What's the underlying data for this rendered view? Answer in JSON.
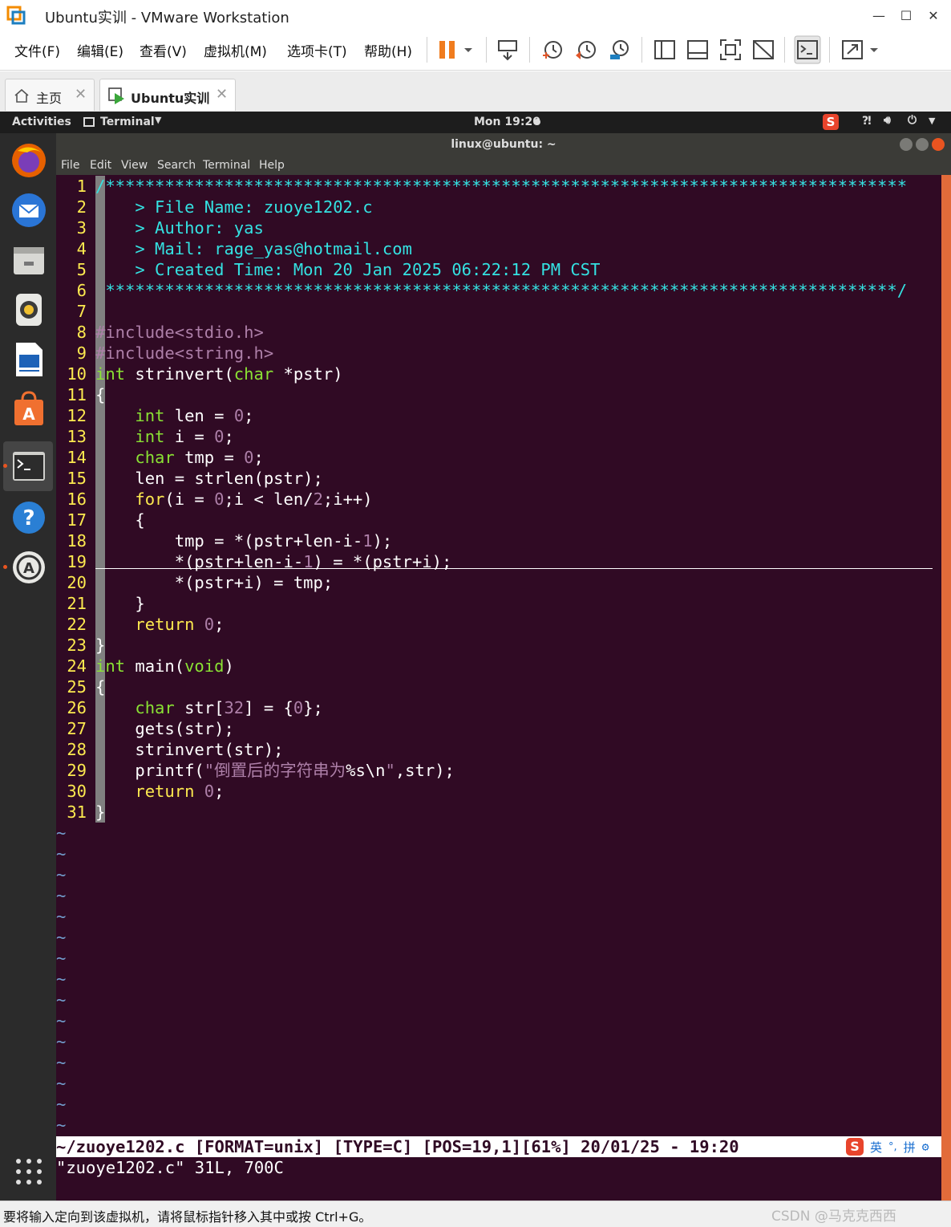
{
  "window": {
    "title": "Ubuntu实训 - VMware Workstation",
    "controls": [
      "—",
      "☐",
      "✕"
    ]
  },
  "menubar": {
    "items": [
      "文件(F)",
      "编辑(E)",
      "查看(V)",
      "虚拟机(M)",
      "选项卡(T)",
      "帮助(H)"
    ]
  },
  "toolbar": {
    "icons": [
      "pause-icon",
      "dropdown-icon",
      "send-ctrl-alt-del-icon",
      "snapshot-icon",
      "revert-snapshot-icon",
      "snapshot-manager-icon",
      "sidebar-icon",
      "thumbnail-icon",
      "fullscreen-icon",
      "unity-icon",
      "console-view-icon",
      "stretch-icon"
    ]
  },
  "tabs": [
    {
      "label": "主页",
      "icon": "home-icon",
      "active": false
    },
    {
      "label": "Ubuntu实训",
      "icon": "vm-running-icon",
      "active": true
    }
  ],
  "ubuntu": {
    "activities": "Activities",
    "app_menu": "Terminal",
    "clock": "Mon 19:20",
    "dock": [
      "firefox-icon",
      "thunderbird-icon",
      "files-icon",
      "rhythmbox-icon",
      "writer-icon",
      "software-icon",
      "terminal-icon",
      "help-icon",
      "updater-icon"
    ],
    "apps_grid_icon": "show-applications-icon"
  },
  "terminal": {
    "title": "linux@ubuntu: ~",
    "menu": [
      "File",
      "Edit",
      "View",
      "Search",
      "Terminal",
      "Help"
    ]
  },
  "vim": {
    "lines": [
      {
        "n": "1",
        "segs": [
          {
            "t": "/*********************************************************************************",
            "c": "cyan"
          }
        ]
      },
      {
        "n": "2",
        "segs": [
          {
            "t": "    > File Name: zuoye1202.c",
            "c": "cyan"
          }
        ]
      },
      {
        "n": "3",
        "segs": [
          {
            "t": "    > Author: yas",
            "c": "cyan"
          }
        ]
      },
      {
        "n": "4",
        "segs": [
          {
            "t": "    > Mail: rage_yas@hotmail.com",
            "c": "cyan"
          }
        ]
      },
      {
        "n": "5",
        "segs": [
          {
            "t": "    > Created Time: Mon 20 Jan 2025 06:22:12 PM CST",
            "c": "cyan"
          }
        ]
      },
      {
        "n": "6",
        "segs": [
          {
            "t": " ********************************************************************************/",
            "c": "cyan"
          }
        ]
      },
      {
        "n": "7",
        "segs": []
      },
      {
        "n": "8",
        "segs": [
          {
            "t": "#include<stdio.h>",
            "c": "purple"
          }
        ]
      },
      {
        "n": "9",
        "segs": [
          {
            "t": "#include<string.h>",
            "c": "purple"
          }
        ]
      },
      {
        "n": "10",
        "segs": [
          {
            "t": "int",
            "c": "green"
          },
          {
            "t": " strinvert(",
            "c": "white"
          },
          {
            "t": "char",
            "c": "green"
          },
          {
            "t": " *pstr)",
            "c": "white"
          }
        ]
      },
      {
        "n": "11",
        "segs": [
          {
            "t": "{",
            "c": "white"
          }
        ]
      },
      {
        "n": "12",
        "segs": [
          {
            "t": "    ",
            "c": "white"
          },
          {
            "t": "int",
            "c": "green"
          },
          {
            "t": " len = ",
            "c": "white"
          },
          {
            "t": "0",
            "c": "purple"
          },
          {
            "t": ";",
            "c": "white"
          }
        ]
      },
      {
        "n": "13",
        "segs": [
          {
            "t": "    ",
            "c": "white"
          },
          {
            "t": "int",
            "c": "green"
          },
          {
            "t": " i = ",
            "c": "white"
          },
          {
            "t": "0",
            "c": "purple"
          },
          {
            "t": ";",
            "c": "white"
          }
        ]
      },
      {
        "n": "14",
        "segs": [
          {
            "t": "    ",
            "c": "white"
          },
          {
            "t": "char",
            "c": "green"
          },
          {
            "t": " tmp = ",
            "c": "white"
          },
          {
            "t": "0",
            "c": "purple"
          },
          {
            "t": ";",
            "c": "white"
          }
        ]
      },
      {
        "n": "15",
        "segs": [
          {
            "t": "    len = strlen(pstr);",
            "c": "white"
          }
        ]
      },
      {
        "n": "16",
        "segs": [
          {
            "t": "    ",
            "c": "white"
          },
          {
            "t": "for",
            "c": "yellow"
          },
          {
            "t": "(i = ",
            "c": "white"
          },
          {
            "t": "0",
            "c": "purple"
          },
          {
            "t": ";i < len/",
            "c": "white"
          },
          {
            "t": "2",
            "c": "purple"
          },
          {
            "t": ";i++)",
            "c": "white"
          }
        ]
      },
      {
        "n": "17",
        "segs": [
          {
            "t": "    {",
            "c": "white"
          }
        ]
      },
      {
        "n": "18",
        "segs": [
          {
            "t": "        tmp = *(pstr+len-i-",
            "c": "white"
          },
          {
            "t": "1",
            "c": "purple"
          },
          {
            "t": ");",
            "c": "white"
          }
        ]
      },
      {
        "n": "19",
        "segs": [
          {
            "t": "        *(pstr+len-i-",
            "c": "white"
          },
          {
            "t": "1",
            "c": "purple"
          },
          {
            "t": ") = *(pstr+i);",
            "c": "white"
          }
        ]
      },
      {
        "n": "20",
        "segs": [
          {
            "t": "        *(pstr+i) = tmp;",
            "c": "white"
          }
        ]
      },
      {
        "n": "21",
        "segs": [
          {
            "t": "    }",
            "c": "white"
          }
        ]
      },
      {
        "n": "22",
        "segs": [
          {
            "t": "    ",
            "c": "white"
          },
          {
            "t": "return",
            "c": "yellow"
          },
          {
            "t": " ",
            "c": "white"
          },
          {
            "t": "0",
            "c": "purple"
          },
          {
            "t": ";",
            "c": "white"
          }
        ]
      },
      {
        "n": "23",
        "segs": [
          {
            "t": "}",
            "c": "white"
          }
        ]
      },
      {
        "n": "24",
        "segs": [
          {
            "t": "int",
            "c": "green"
          },
          {
            "t": " main(",
            "c": "white"
          },
          {
            "t": "void",
            "c": "green"
          },
          {
            "t": ")",
            "c": "white"
          }
        ]
      },
      {
        "n": "25",
        "segs": [
          {
            "t": "{",
            "c": "white"
          }
        ]
      },
      {
        "n": "26",
        "segs": [
          {
            "t": "    ",
            "c": "white"
          },
          {
            "t": "char",
            "c": "green"
          },
          {
            "t": " str[",
            "c": "white"
          },
          {
            "t": "32",
            "c": "purple"
          },
          {
            "t": "] = {",
            "c": "white"
          },
          {
            "t": "0",
            "c": "purple"
          },
          {
            "t": "};",
            "c": "white"
          }
        ]
      },
      {
        "n": "27",
        "segs": [
          {
            "t": "    gets(str);",
            "c": "white"
          }
        ]
      },
      {
        "n": "28",
        "segs": [
          {
            "t": "    strinvert(str);",
            "c": "white"
          }
        ]
      },
      {
        "n": "29",
        "segs": [
          {
            "t": "    printf(",
            "c": "white"
          },
          {
            "t": "\"倒置后的字符串为",
            "c": "purple"
          },
          {
            "t": "%s\\n",
            "c": "white"
          },
          {
            "t": "\"",
            "c": "purple"
          },
          {
            "t": ",str);",
            "c": "white"
          }
        ]
      },
      {
        "n": "30",
        "segs": [
          {
            "t": "    ",
            "c": "white"
          },
          {
            "t": "return",
            "c": "yellow"
          },
          {
            "t": " ",
            "c": "white"
          },
          {
            "t": "0",
            "c": "purple"
          },
          {
            "t": ";",
            "c": "white"
          }
        ]
      },
      {
        "n": "31",
        "segs": [
          {
            "t": "}",
            "c": "white"
          }
        ]
      }
    ],
    "tilde": "~",
    "tilde_count": 15,
    "status": "~/zuoye1202.c [FORMAT=unix] [TYPE=C] [POS=19,1][61%] 20/01/25 - 19:20",
    "message": "\"zuoye1202.c\" 31L, 700C",
    "ime": {
      "mode": "英",
      "punct": "°,",
      "pinyin": "拼",
      "settings_icon": "gear-icon"
    }
  },
  "statusbar": {
    "text": "要将输入定向到该虚拟机，请将鼠标指针移入其中或按 Ctrl+G。",
    "watermark": "CSDN @马克克西西"
  },
  "colors": {
    "cyan": "#34e2e2",
    "purple": "#ad7fa8",
    "green": "#8ae234",
    "yellow": "#fce94f",
    "white": "#ffffff",
    "terminal_bg": "#300a24",
    "accent": "#e95420"
  }
}
